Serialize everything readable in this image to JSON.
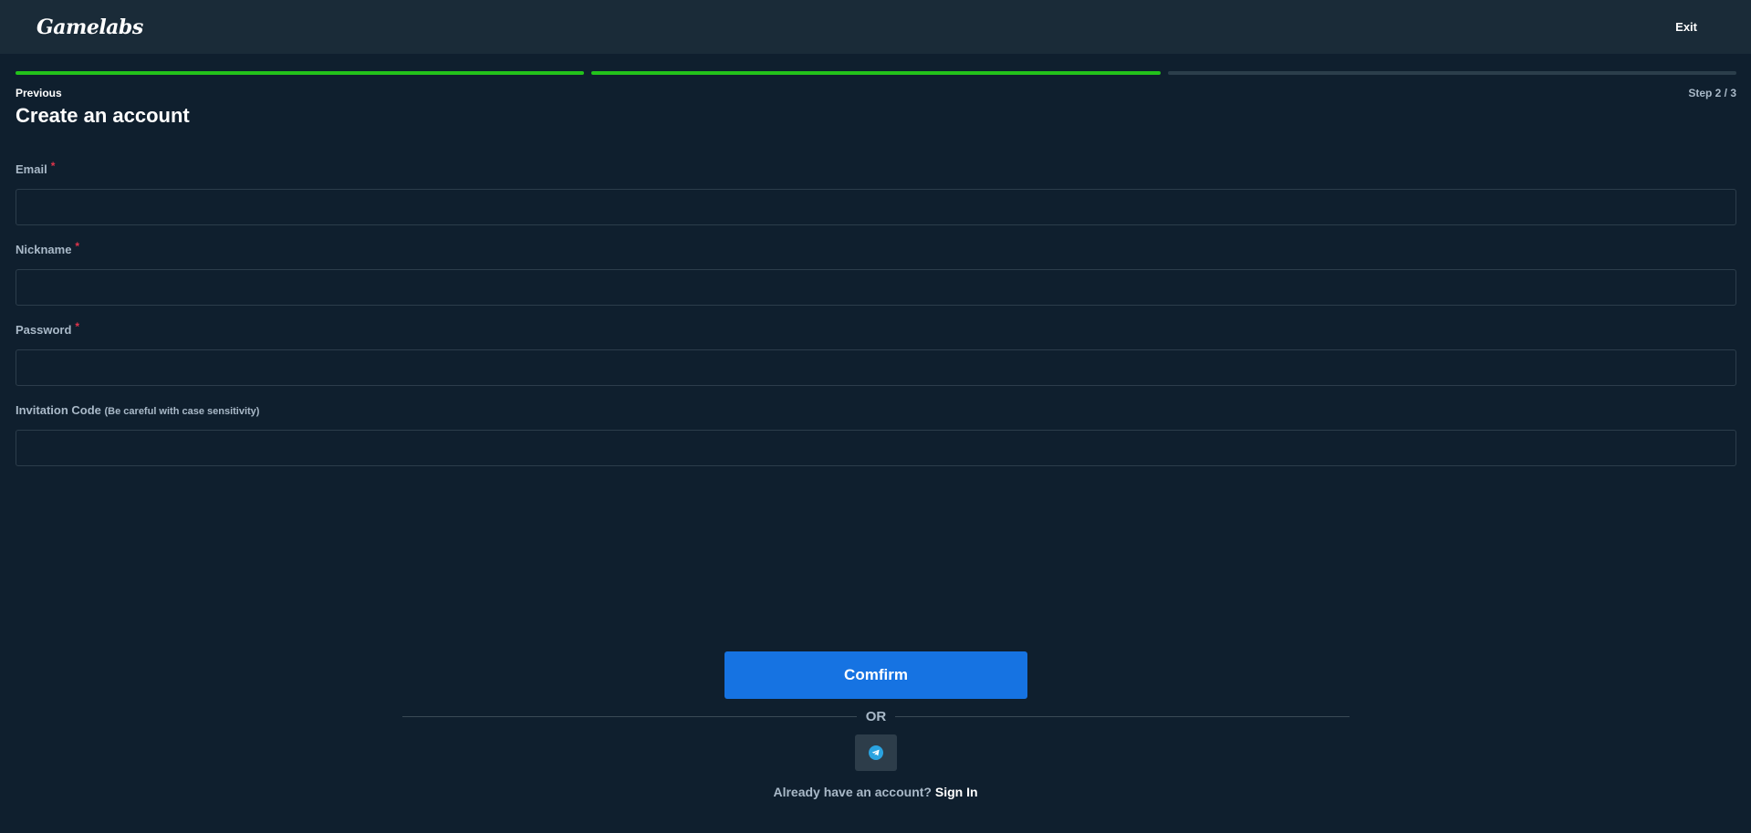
{
  "header": {
    "logo_text": "Gamelabs",
    "exit_label": "Exit"
  },
  "progress": {
    "current_step": 2,
    "total_steps": 3,
    "previous_label": "Previous",
    "step_label": "Step 2 / 3"
  },
  "page": {
    "title": "Create an account"
  },
  "form": {
    "email": {
      "label": "Email",
      "required_mark": "*",
      "value": "",
      "placeholder": ""
    },
    "nickname": {
      "label": "Nickname",
      "required_mark": "*",
      "value": "",
      "placeholder": ""
    },
    "password": {
      "label": "Password",
      "required_mark": "*",
      "value": "",
      "placeholder": ""
    },
    "invitation": {
      "label": "Invitation Code",
      "hint": "(Be careful with case sensitivity)",
      "value": "",
      "placeholder": ""
    }
  },
  "actions": {
    "confirm_label": "Comfirm",
    "or_label": "OR",
    "telegram_icon": "telegram-icon",
    "already_text": "Already have an account?",
    "signin_label": "Sign In"
  },
  "colors": {
    "background": "#0f1f2e",
    "header": "#1a2b38",
    "progress_done": "#23c21b",
    "progress_todo": "#2b3e4b",
    "primary_button": "#1673e2",
    "required": "#e0344b",
    "telegram": "#2aa3e0"
  }
}
